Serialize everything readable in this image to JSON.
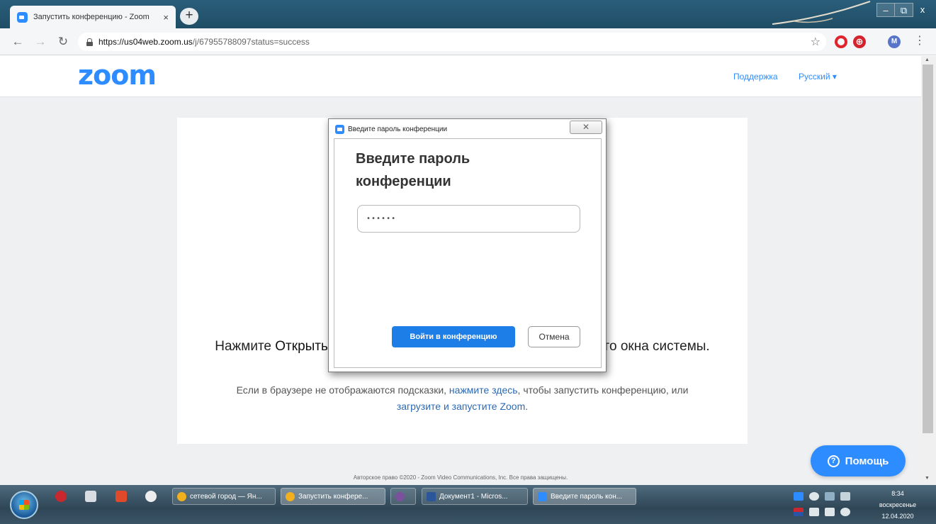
{
  "browser": {
    "tab_title": "Запустить конференцию - Zoom",
    "tab_close": "×",
    "new_tab": "+",
    "window_controls": {
      "minimize": "–",
      "maximize": "⧉",
      "close": "x"
    },
    "url_host": "https://us04web.zoom.us",
    "url_path": "/j/67955788097status=success",
    "avatar_letter": "M",
    "icons": [
      "back-arrow-icon",
      "forward-arrow-icon",
      "reload-icon",
      "lock-icon",
      "star-icon",
      "opera-icon",
      "vpn-icon",
      "menu-dots-icon"
    ]
  },
  "header": {
    "logo": "zoom",
    "support": "Поддержка",
    "language": "Русский ▾"
  },
  "content": {
    "instruction_start": "Нажмите ",
    "instruction_bold": "Открыть",
    "instruction_end": "ого окна системы.",
    "sub_1": "Если в браузере не отображаются подсказки, ",
    "sub_link_1": "нажмите здесь",
    "sub_2": ", чтобы запустить конференцию, или",
    "sub_link_2": "загрузите и запустите Zoom",
    "sub_3": "."
  },
  "copyright": "Авторское право ©2020 - Zoom Video Communications, Inc. Все права защищены.",
  "help_button": "Помощь",
  "dialog": {
    "title": "Введите пароль конференции",
    "close": "✕",
    "heading": "Введите пароль конференции",
    "password_value": "••••••",
    "join_label": "Войти в конференцию",
    "cancel_label": "Отмена"
  },
  "taskbar": {
    "tasks": [
      {
        "label": "сетевой город — Ян...",
        "color": "#f2b01e"
      },
      {
        "label": "Запустить конфере...",
        "color": "#f2b01e"
      },
      {
        "label": "",
        "color": "#7b519d"
      },
      {
        "label": "Документ1 - Micros...",
        "color": "#2b579a"
      },
      {
        "label": "Введите пароль кон...",
        "color": "#2d8cff"
      }
    ],
    "clock_time": "8:34",
    "clock_day": "воскресенье",
    "clock_date": "12.04.2020"
  },
  "colors": {
    "zoom_blue": "#2d8cff",
    "join_button": "#1e7ee8",
    "link": "#2d6ab4"
  }
}
